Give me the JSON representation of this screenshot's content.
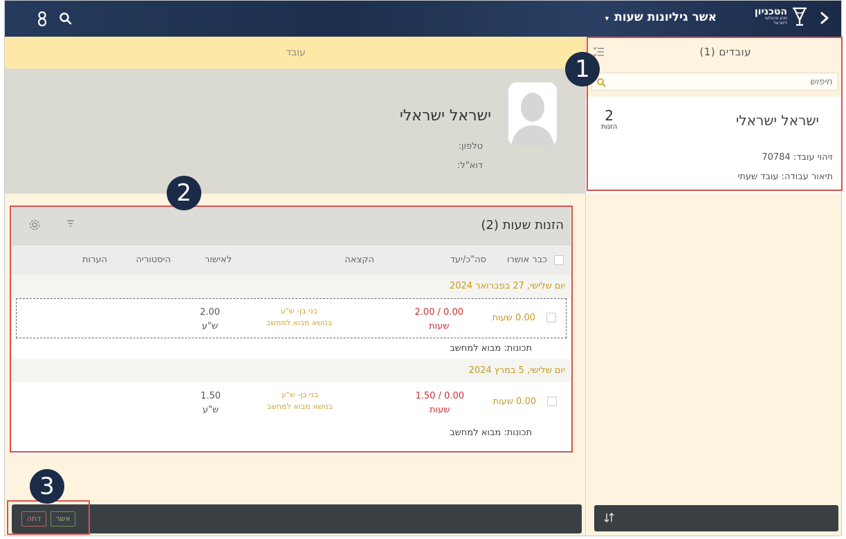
{
  "topbar": {
    "title": "אשר גיליונות שעות",
    "caret": "▾",
    "logo_name": "הטכניון",
    "logo_sub1": "מכון טכנולוגי",
    "logo_sub2": "לישראל",
    "back_icon": "chevron-right-icon",
    "user_icon": "user-icon",
    "search_icon": "search-icon"
  },
  "right_panel": {
    "title": "עובדים (1)",
    "search_placeholder": "חיפוש",
    "employee": {
      "name": "ישראל ישראלי",
      "count": "2",
      "count_label": "הזנות",
      "id_row": "זיהוי עובד: 70784",
      "desc_row": "תיאור עבודה: עובד שעתי"
    }
  },
  "main": {
    "banner": "עובד",
    "profile": {
      "name": "ישראל ישראלי",
      "phone": "טלפון:",
      "email": "דוא\"ל:"
    },
    "entries": {
      "title": "הזנות שעות (2)",
      "columns": {
        "approved": "כבר אושרו",
        "total": "סה\"כ/יעד",
        "allocation": "הקצאה",
        "to_approve": "לאישור",
        "history": "היסטוריה",
        "notes": "הערות"
      },
      "days": [
        {
          "date": "יום שלישי, 27 בפברואר 2024",
          "hours": "0.00 שעות",
          "ratio": "0.00 / 2.00",
          "ratio_unit": "שעות",
          "alloc1": "בני בן- ש\"ע",
          "alloc2": "בנושא מבוא למחשב",
          "approve": "2.00",
          "approve_unit": "ש\"ע",
          "features": "תכונות:  מבוא למחשב"
        },
        {
          "date": "יום שלישי, 5 במרץ 2024",
          "hours": "0.00 שעות",
          "ratio": "0.00 / 1.50",
          "ratio_unit": "שעות",
          "alloc1": "בני בן- ש\"ע",
          "alloc2": "בנושא מבוא למחשב",
          "approve": "1.50",
          "approve_unit": "ש\"ע",
          "features": "תכונות:  מבוא למחשב"
        }
      ]
    }
  },
  "footer": {
    "approve": "אשר",
    "reject": "דחה",
    "sort_icon": "sort-icon"
  },
  "annotations": {
    "one": "1",
    "two": "2",
    "three": "3"
  }
}
